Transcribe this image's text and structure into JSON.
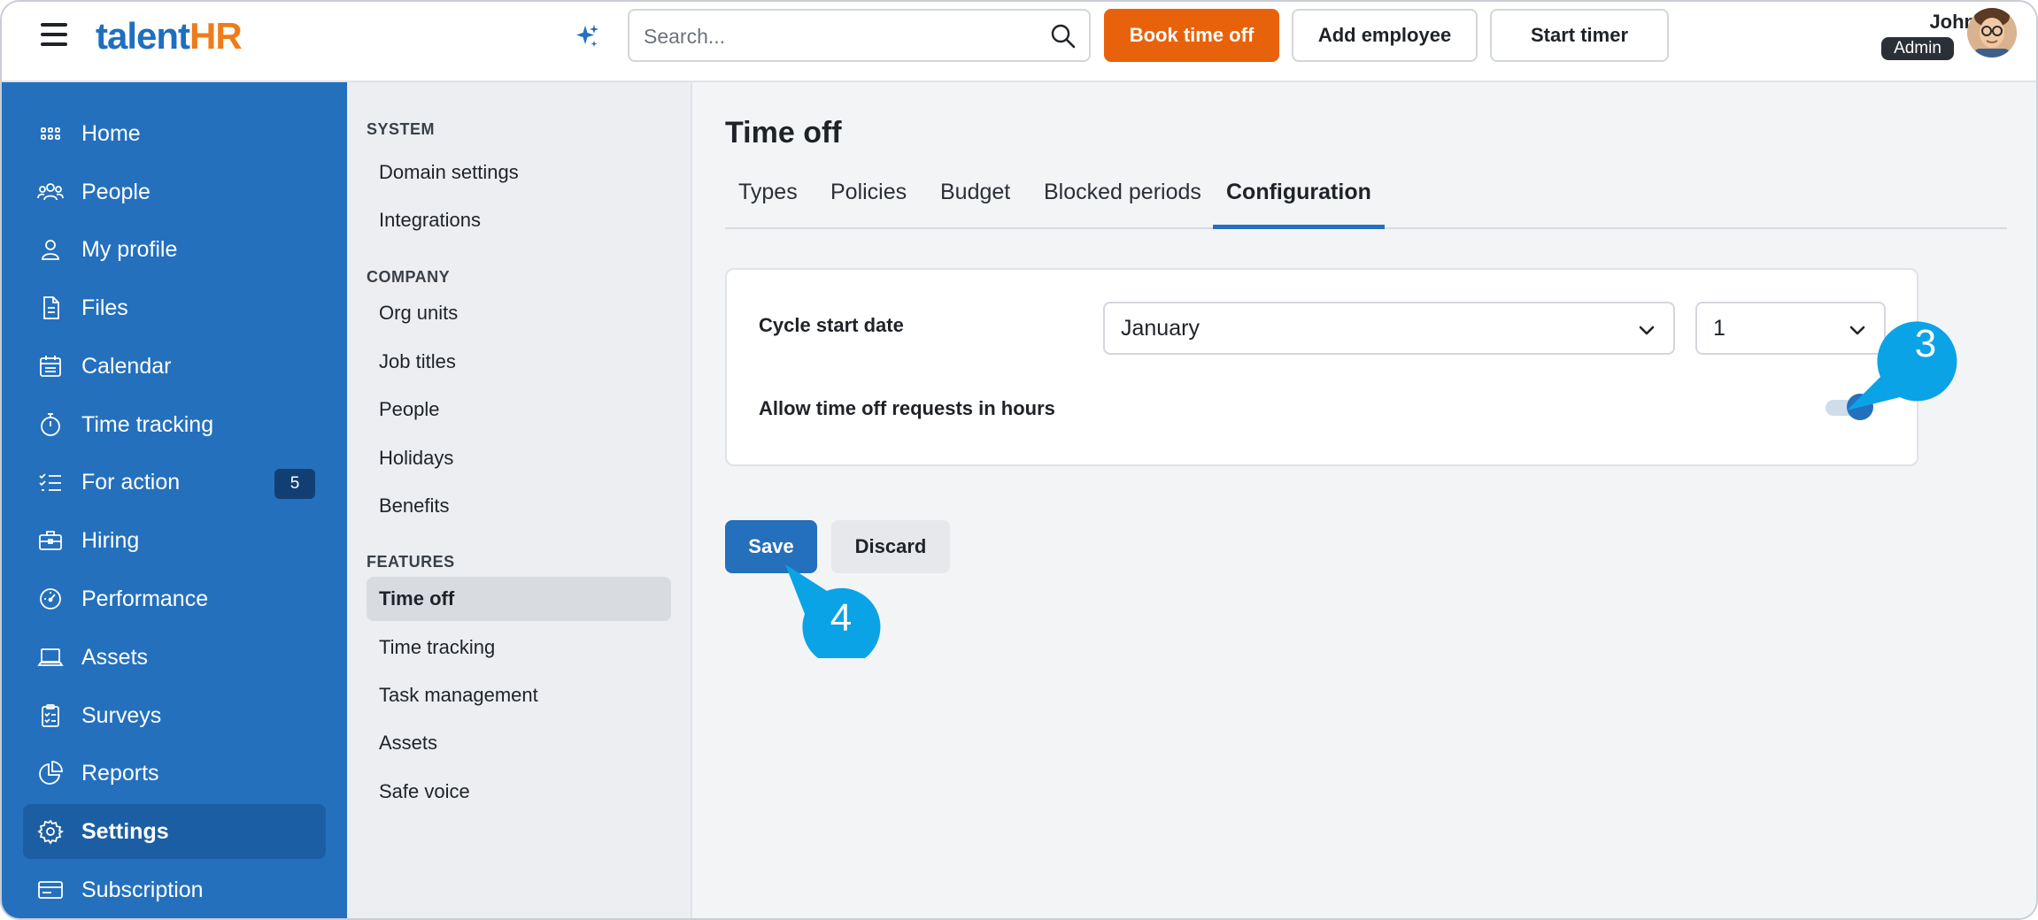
{
  "app": {
    "logo_part1": "talent",
    "logo_part2": "HR"
  },
  "header": {
    "search_placeholder": "Search...",
    "book_time_off": "Book time off",
    "add_employee": "Add employee",
    "start_timer": "Start timer",
    "user_name": "John",
    "user_role": "Admin"
  },
  "nav": {
    "items": [
      {
        "label": "Home",
        "icon": "home-grid-icon"
      },
      {
        "label": "People",
        "icon": "people-icon"
      },
      {
        "label": "My profile",
        "icon": "user-icon"
      },
      {
        "label": "Files",
        "icon": "file-icon"
      },
      {
        "label": "Calendar",
        "icon": "calendar-icon"
      },
      {
        "label": "Time tracking",
        "icon": "stopwatch-icon"
      },
      {
        "label": "For action",
        "icon": "checklist-icon",
        "badge": "5"
      },
      {
        "label": "Hiring",
        "icon": "briefcase-icon"
      },
      {
        "label": "Performance",
        "icon": "gauge-icon"
      },
      {
        "label": "Assets",
        "icon": "laptop-icon"
      },
      {
        "label": "Surveys",
        "icon": "clipboard-icon"
      },
      {
        "label": "Reports",
        "icon": "pie-chart-icon"
      },
      {
        "label": "Settings",
        "icon": "gear-icon",
        "active": true
      },
      {
        "label": "Subscription",
        "icon": "card-icon"
      }
    ]
  },
  "subnav": {
    "system_heading": "SYSTEM",
    "system_items": [
      "Domain settings",
      "Integrations"
    ],
    "company_heading": "COMPANY",
    "company_items": [
      "Org units",
      "Job titles",
      "People",
      "Holidays",
      "Benefits"
    ],
    "features_heading": "FEATURES",
    "features_items": [
      "Time off",
      "Time tracking",
      "Task management",
      "Assets",
      "Safe voice"
    ],
    "active": "Time off"
  },
  "main": {
    "title": "Time off",
    "tabs": [
      "Types",
      "Policies",
      "Budget",
      "Blocked periods",
      "Configuration"
    ],
    "active_tab": "Configuration",
    "cycle_start_label": "Cycle start date",
    "cycle_month": "January",
    "cycle_day": "1",
    "allow_hours_label": "Allow time off requests in hours",
    "allow_hours_enabled": true,
    "save": "Save",
    "discard": "Discard"
  },
  "callouts": {
    "first": "3",
    "second": "4",
    "color": "#0aa3e6"
  },
  "colors": {
    "primary": "#2470bd",
    "accent_orange": "#e8620b",
    "nav_bg": "#2470bd"
  }
}
